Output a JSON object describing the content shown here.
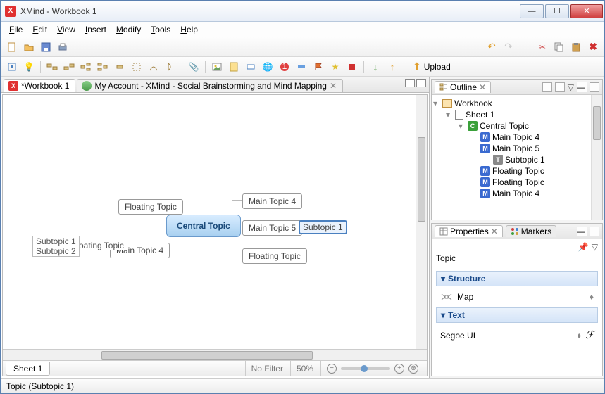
{
  "window": {
    "title": "XMind - Workbook 1"
  },
  "menu": {
    "file": "File",
    "edit": "Edit",
    "view": "View",
    "insert": "Insert",
    "modify": "Modify",
    "tools": "Tools",
    "help": "Help"
  },
  "toolbar": {
    "upload_label": "Upload"
  },
  "editor": {
    "tab1": "*Workbook 1",
    "tab2": "My Account - XMind - Social Brainstorming and Mind Mapping",
    "central": "Central Topic",
    "main4": "Main Topic 4",
    "main5": "Main Topic 5",
    "main4b": "Main Topic 4",
    "sub1": "Subtopic 1",
    "sub1b": "Subtopic 1",
    "sub2": "Subtopic 2",
    "float1": "Floating Topic",
    "float2": "Floating Topic",
    "float3": "Floating Topic"
  },
  "sheetbar": {
    "sheet": "Sheet 1",
    "filter": "No Filter",
    "zoom": "50%"
  },
  "outline": {
    "title": "Outline",
    "items": [
      {
        "label": "Workbook",
        "icon": "wb",
        "indent": 0
      },
      {
        "label": "Sheet 1",
        "icon": "sh",
        "indent": 1
      },
      {
        "label": "Central Topic",
        "icon": "c",
        "indent": 2
      },
      {
        "label": "Main Topic 4",
        "icon": "m",
        "indent": 3
      },
      {
        "label": "Main Topic 5",
        "icon": "m",
        "indent": 3
      },
      {
        "label": "Subtopic 1",
        "icon": "t",
        "indent": 4
      },
      {
        "label": "Floating Topic",
        "icon": "m",
        "indent": 3
      },
      {
        "label": "Floating Topic",
        "icon": "m",
        "indent": 3
      },
      {
        "label": "Main Topic 4",
        "icon": "m",
        "indent": 3
      }
    ]
  },
  "properties": {
    "tab_props": "Properties",
    "tab_markers": "Markers",
    "heading": "Topic",
    "sec_structure": "Structure",
    "structure_val": "Map",
    "sec_text": "Text",
    "font_val": "Segoe UI"
  },
  "status": {
    "text": "Topic (Subtopic 1)"
  }
}
